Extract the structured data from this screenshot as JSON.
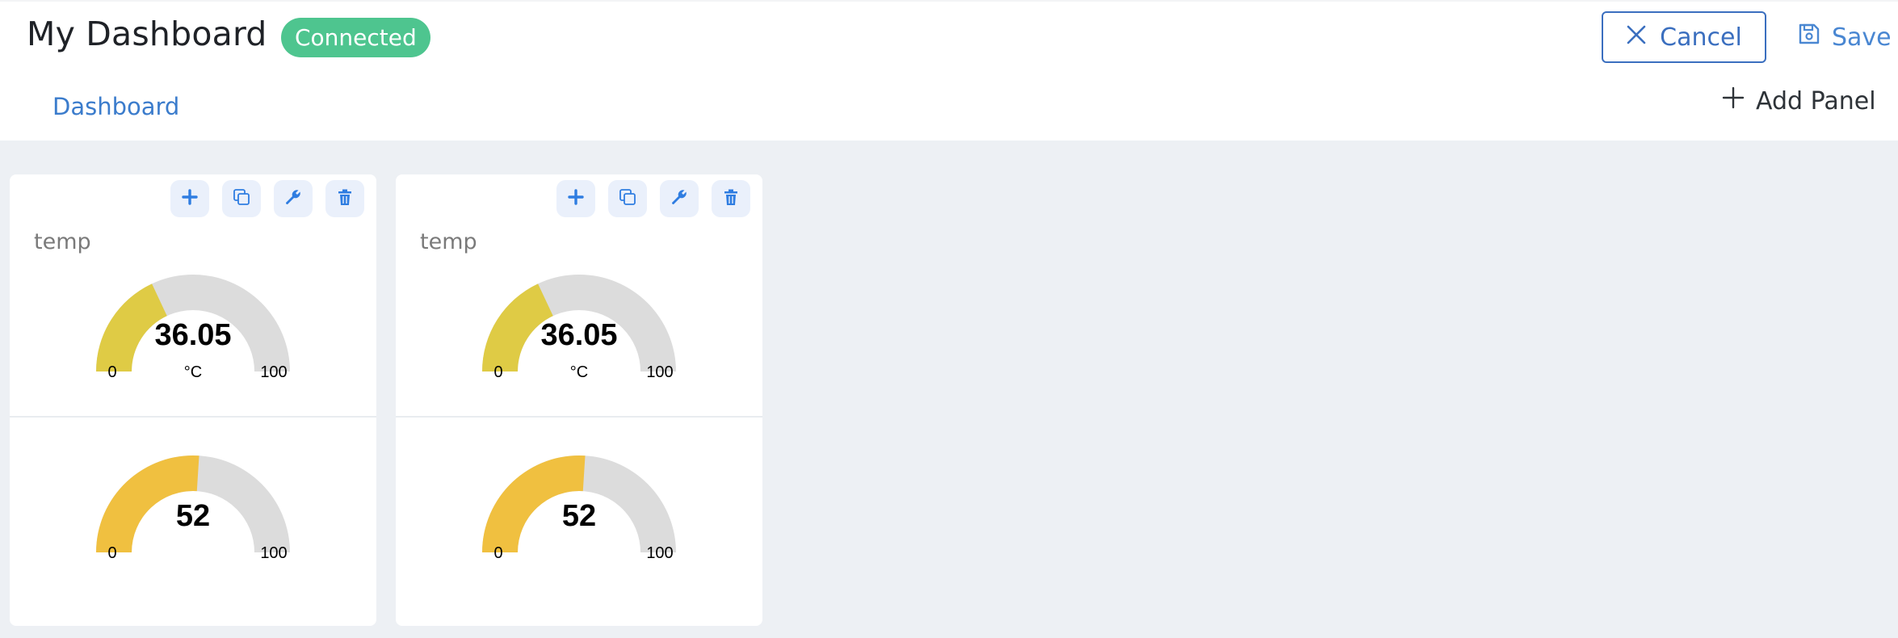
{
  "header": {
    "title": "My Dashboard",
    "status_badge": "Connected",
    "tab_label": "Dashboard",
    "cancel_label": "Cancel",
    "save_label": "Save",
    "add_panel_label": "Add Panel"
  },
  "colors": {
    "accent": "#3b6fbf",
    "badge": "#4ec58f",
    "gauge_temp": "#dfcb45",
    "gauge_humidity": "#f0c040",
    "gauge_track": "#dcdcdc",
    "canvas_bg": "#edf0f4"
  },
  "panels": [
    {
      "toolbar": [
        "plus-icon",
        "copy-icon",
        "wrench-icon",
        "trash-icon"
      ],
      "gauges": [
        {
          "label": "temp",
          "value": "36.05",
          "value_num": 36.05,
          "unit": "°C",
          "min": "0",
          "max": "100",
          "min_num": 0,
          "max_num": 100,
          "color": "#dfcb45"
        },
        {
          "label": "",
          "value": "52",
          "value_num": 52,
          "unit": "",
          "min": "0",
          "max": "100",
          "min_num": 0,
          "max_num": 100,
          "color": "#f0c040"
        }
      ]
    },
    {
      "toolbar": [
        "plus-icon",
        "copy-icon",
        "wrench-icon",
        "trash-icon"
      ],
      "gauges": [
        {
          "label": "temp",
          "value": "36.05",
          "value_num": 36.05,
          "unit": "°C",
          "min": "0",
          "max": "100",
          "min_num": 0,
          "max_num": 100,
          "color": "#dfcb45"
        },
        {
          "label": "",
          "value": "52",
          "value_num": 52,
          "unit": "",
          "min": "0",
          "max": "100",
          "min_num": 0,
          "max_num": 100,
          "color": "#f0c040"
        }
      ]
    }
  ]
}
